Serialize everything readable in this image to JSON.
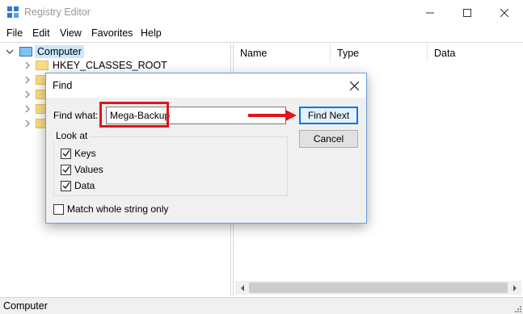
{
  "window": {
    "title": "Registry Editor"
  },
  "menu": [
    "File",
    "Edit",
    "View",
    "Favorites",
    "Help"
  ],
  "tree": {
    "root_label": "Computer",
    "first_child": "HKEY_CLASSES_ROOT"
  },
  "list": {
    "columns": [
      "Name",
      "Type",
      "Data"
    ]
  },
  "status": {
    "text": "Computer"
  },
  "find_dialog": {
    "title": "Find",
    "find_what_label": "Find what:",
    "find_what_value": "Mega-Backup",
    "find_next_label": "Find Next",
    "cancel_label": "Cancel",
    "look_at_label": "Look at",
    "keys_label": "Keys",
    "values_label": "Values",
    "data_label": "Data",
    "match_whole_label": "Match whole string only",
    "keys_checked": true,
    "values_checked": true,
    "data_checked": true,
    "match_whole_checked": false
  },
  "colors": {
    "annotation_red": "#e0141b",
    "accent_blue": "#0078d7",
    "selection": "#cce8ff"
  }
}
